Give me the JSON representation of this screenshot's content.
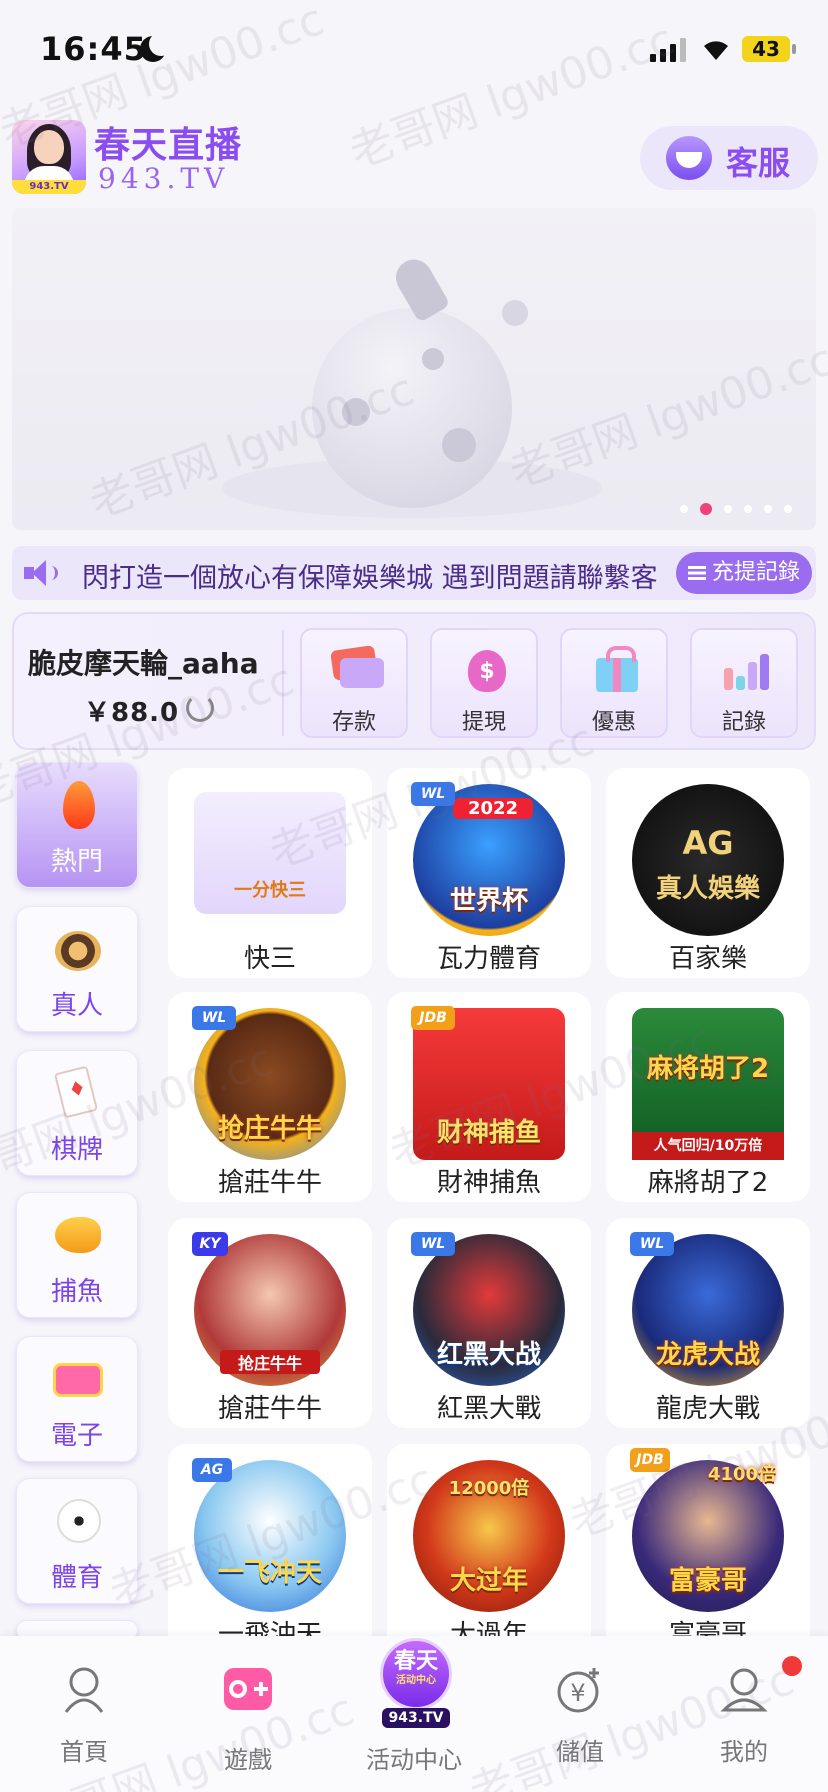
{
  "status_bar": {
    "time": "16:45",
    "battery": "43"
  },
  "header": {
    "logo_tag": "943.TV",
    "logo_title": "春天直播",
    "logo_sub": "943.TV",
    "service_label": "客服"
  },
  "banner": {
    "slide_count": 6,
    "active_slide": 1
  },
  "marquee": {
    "text": "歡迎來到春天直播，打造一個放心有保障娛樂城  遇到問題請聯繫客服",
    "visible_text": "閃打造一個放心有保障娛樂城  遇到問題請聯繫客",
    "records_button": "充提記錄"
  },
  "wallet": {
    "username": "脆皮摩天輪_aaha",
    "balance": "￥88.0",
    "actions": [
      {
        "label": "存款",
        "icon": "cards-icon"
      },
      {
        "label": "提現",
        "icon": "money-bag-icon"
      },
      {
        "label": "優惠",
        "icon": "gift-icon"
      },
      {
        "label": "記錄",
        "icon": "bar-chart-icon"
      }
    ]
  },
  "categories": [
    {
      "label": "熱門",
      "icon": "flame-icon",
      "active": true
    },
    {
      "label": "真人",
      "icon": "poker-chip-icon"
    },
    {
      "label": "棋牌",
      "icon": "playing-card-icon"
    },
    {
      "label": "捕魚",
      "icon": "fish-icon"
    },
    {
      "label": "電子",
      "icon": "slot-machine-icon"
    },
    {
      "label": "體育",
      "icon": "soccer-ball-icon"
    }
  ],
  "games": [
    {
      "name": "快三",
      "thumb_text": "一分快三"
    },
    {
      "name": "瓦力體育",
      "thumb_text": "世界杯",
      "badge": "WL",
      "year": "2022"
    },
    {
      "name": "百家樂",
      "thumb_text": "真人娛樂",
      "badge": "AG"
    },
    {
      "name": "搶莊牛牛",
      "thumb_text": "抢庄牛牛",
      "badge": "WL"
    },
    {
      "name": "財神捕魚",
      "thumb_text": "财神捕鱼",
      "badge": "JDB"
    },
    {
      "name": "麻將胡了2",
      "thumb_text": "麻将胡了2",
      "banner": "人气回归/10万倍"
    },
    {
      "name": "搶莊牛牛",
      "thumb_text": "抢庄牛牛",
      "badge": "KY"
    },
    {
      "name": "紅黑大戰",
      "thumb_text": "红黑大战",
      "badge": "WL"
    },
    {
      "name": "龍虎大戰",
      "thumb_text": "龙虎大战",
      "badge": "WL"
    },
    {
      "name": "一飛沖天",
      "thumb_text": "一飞冲天",
      "badge": "AG"
    },
    {
      "name": "大過年",
      "thumb_text": "大过年",
      "multiplier": "12000倍"
    },
    {
      "name": "富豪哥",
      "thumb_text": "富豪哥",
      "badge": "JDB",
      "multiplier": "4100倍"
    }
  ],
  "bottom_nav": [
    {
      "label": "首頁",
      "icon": "home-avatar-icon"
    },
    {
      "label": "遊戲",
      "icon": "gamepad-icon"
    },
    {
      "label": "活动中心",
      "icon": "activity-center-logo",
      "logo_top": "春天",
      "logo_mid": "活动中心",
      "logo_tv": "943.TV"
    },
    {
      "label": "儲值",
      "icon": "deposit-yen-icon"
    },
    {
      "label": "我的",
      "icon": "profile-icon",
      "has_notification": true
    }
  ],
  "watermark": "老哥网 lgw00.cc",
  "colors": {
    "accent": "#8b4df0",
    "nav_active": "#7b45e8",
    "notification": "#f03a3a"
  }
}
